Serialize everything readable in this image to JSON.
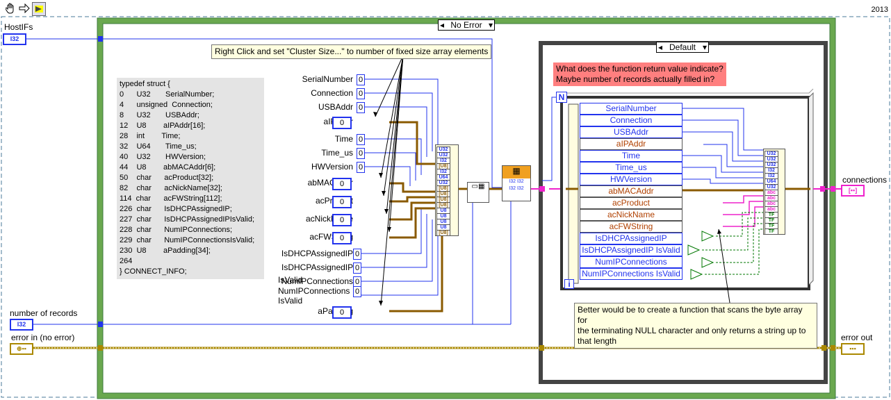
{
  "toolbar": {
    "year": "2013",
    "tools": [
      "hand-icon",
      "arrow-icon",
      "run-arrow-icon"
    ]
  },
  "case_outer": {
    "selector": "No Error"
  },
  "case_inner": {
    "selector": "Default"
  },
  "labels": {
    "host_ifs": "HostIFs",
    "host_ifs_term": "I32",
    "number_of_records": "number of records",
    "number_of_records_term": "I32",
    "error_in": "error in (no error)",
    "error_out": "error out",
    "connections": "connections"
  },
  "comments": {
    "cluster_size": "Right Click and set \"Cluster Size...\" to number of fixed size array elements",
    "return_value": [
      "What does the function return value indicate?",
      "Maybe number of records actually filled in?"
    ],
    "better": [
      "Better would be to create a function that scans the byte array for",
      "the terminating NULL character and only returns a string up to",
      "that length"
    ]
  },
  "typedef": [
    "typedef struct {",
    "0      U32       SerialNumber;",
    "4      unsigned  Connection;",
    "8      U32       USBAddr;",
    "12    U8        aIPAddr[16];",
    "28    int        Time;",
    "32    U64       Time_us;",
    "40    U32       HWVersion;",
    "44    U8        abMACAddr[6];",
    "50    char      acProduct[32];",
    "82    char      acNickName[32];",
    "114  char      acFWString[112];",
    "226  char      IsDHCPAssignedIP;",
    "227  char      IsDHCPAssignedIPIsValid;",
    "228  char      NumIPConnections;",
    "229  char      NumIPConnectionsIsValid;",
    "230  U8        aPadding[34];",
    "264",
    "} CONNECT_INFO;"
  ],
  "left_constants": [
    {
      "label": "SerialNumber",
      "value": "0"
    },
    {
      "label": "Connection",
      "value": "0"
    },
    {
      "label": "USBAddr",
      "value": "0"
    },
    {
      "label": "aIPAddr",
      "value": "0"
    },
    {
      "label": "Time",
      "value": "0"
    },
    {
      "label": "Time_us",
      "value": "0"
    },
    {
      "label": "HWVersion",
      "value": "0"
    },
    {
      "label": "abMACAddr",
      "value": "0"
    },
    {
      "label": "acProduct",
      "value": "0"
    },
    {
      "label": "acNickName",
      "value": "0"
    },
    {
      "label": "acFWString",
      "value": "0"
    },
    {
      "label": "IsDHCPAssignedIP",
      "value": "0"
    },
    {
      "label": "IsDHCPAssignedIP",
      "value": "0"
    },
    {
      "label": "IsValid",
      "value": "0"
    },
    {
      "label": "NumIPConnections",
      "value": "0"
    },
    {
      "label": "NumIPConnections",
      "value": "0"
    },
    {
      "label": "IsValid",
      "value": "0"
    },
    {
      "label": "aPadding",
      "value": "0"
    }
  ],
  "loop_fields": [
    {
      "name": "SerialNumber",
      "kind": "num"
    },
    {
      "name": "Connection",
      "kind": "num"
    },
    {
      "name": "USBAddr",
      "kind": "num"
    },
    {
      "name": "aIPAddr",
      "kind": "arr"
    },
    {
      "name": "Time",
      "kind": "num"
    },
    {
      "name": "Time_us",
      "kind": "num"
    },
    {
      "name": "HWVersion",
      "kind": "num"
    },
    {
      "name": "abMACAddr",
      "kind": "arr"
    },
    {
      "name": "acProduct",
      "kind": "arr"
    },
    {
      "name": "acNickName",
      "kind": "arr"
    },
    {
      "name": "acFWString",
      "kind": "arr"
    },
    {
      "name": "IsDHCPAssignedIP",
      "kind": "num"
    },
    {
      "name": "IsDHCPAssignedIP IsValid",
      "kind": "num"
    },
    {
      "name": "NumIPConnections",
      "kind": "num"
    },
    {
      "name": "NumIPConnections IsValid",
      "kind": "num"
    }
  ],
  "bundle_types_left": [
    "U32",
    "U32",
    "I32",
    "[U8]",
    "I32",
    "U64",
    "U32",
    "[U8]",
    "[U8]",
    "[U8]",
    "[U8]",
    "U8",
    "U8",
    "U8",
    "U8",
    "[U8]"
  ],
  "bundle_types_right": [
    "U32",
    "U32",
    "U32",
    "I32",
    "I32",
    "U64",
    "U32",
    "abc",
    "abc",
    "abc",
    "abc",
    "TF",
    "TF",
    "TF",
    "TF"
  ],
  "loop_markers": {
    "n": "N",
    "i": "i"
  },
  "colors": {
    "int_wire": "#2233ee",
    "cluster_wire": "#8a5a00",
    "error_wire": "#aa8800",
    "string_wire": "#ee22cc",
    "bool_wire": "#007700",
    "case_frame": "#6aa84f"
  }
}
